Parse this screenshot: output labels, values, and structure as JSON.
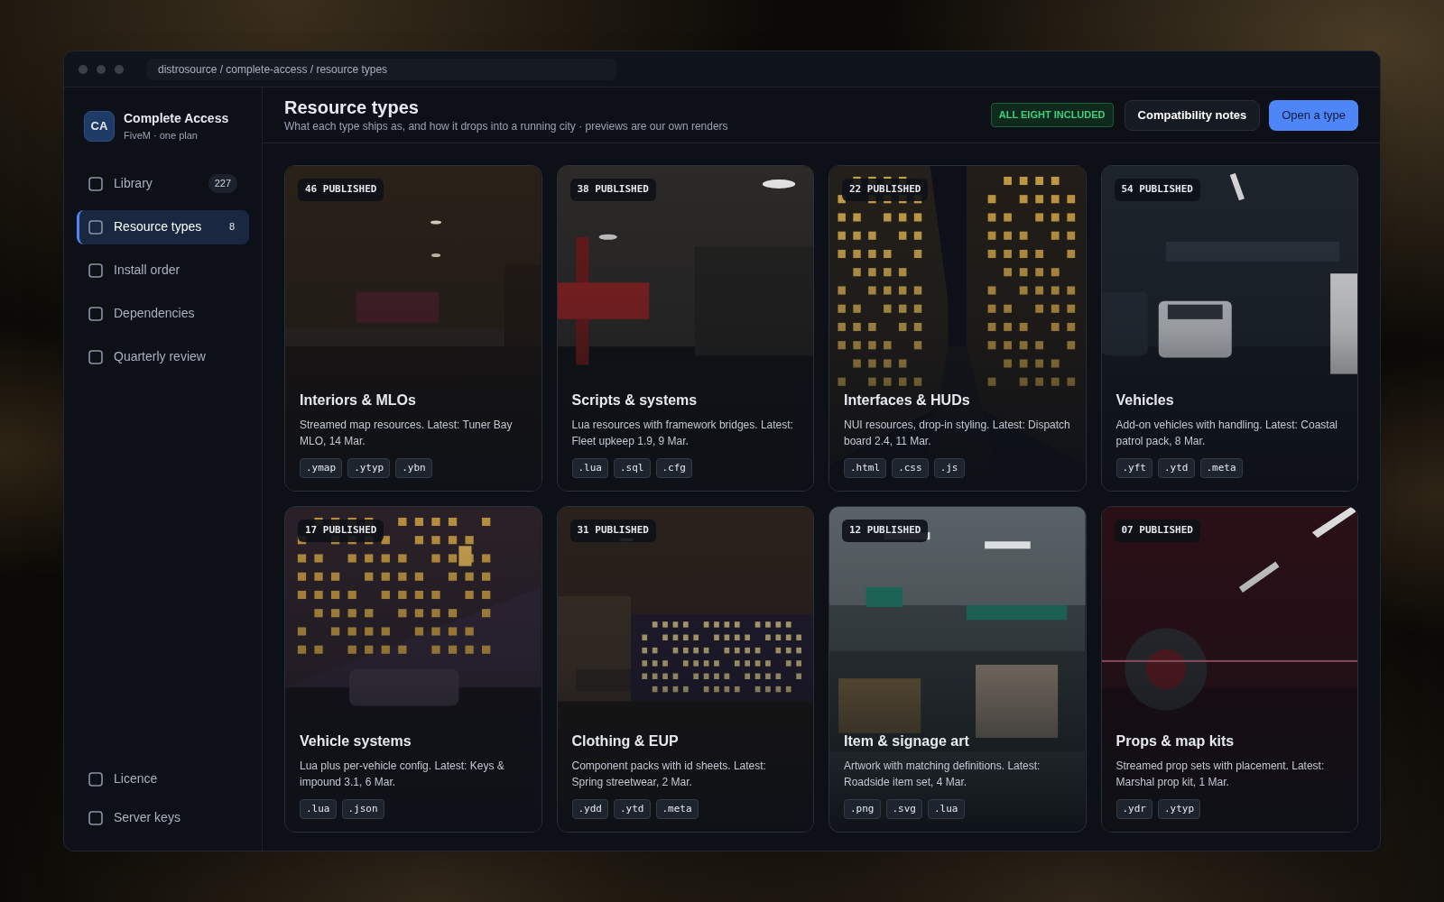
{
  "window": {
    "breadcrumb": "distrosource / complete-access / resource types"
  },
  "brand": {
    "initials": "CA",
    "name": "Complete Access",
    "subtitle": "FiveM · one plan"
  },
  "nav": [
    {
      "label": "Library",
      "count": "227",
      "selected": false
    },
    {
      "label": "Resource types",
      "count": "8",
      "selected": true
    },
    {
      "label": "Install order",
      "selected": false
    },
    {
      "label": "Dependencies",
      "selected": false
    },
    {
      "label": "Quarterly review",
      "selected": false
    }
  ],
  "nav_footer": [
    {
      "label": "Licence"
    },
    {
      "label": "Server keys"
    }
  ],
  "header": {
    "title": "Resource types",
    "subtitle": "What each type ships as, and how it drops into a running city · previews are our own renders",
    "badge": "ALL EIGHT INCLUDED",
    "buttons": [
      {
        "label": "Compatibility notes",
        "kind": "secondary"
      },
      {
        "label": "Open a type",
        "kind": "primary"
      }
    ]
  },
  "cards": [
    {
      "badge": "46 PUBLISHED",
      "title": "Interiors & MLOs",
      "description": "Streamed map resources. Latest: Tuner Bay MLO, 14 Mar.",
      "tags": [
        ".ymap",
        ".ytyp",
        ".ybn"
      ],
      "preview": {
        "kind": "picture"
      }
    },
    {
      "badge": "38 PUBLISHED",
      "title": "Scripts & systems",
      "description": "Lua resources with framework bridges. Latest: Fleet upkeep 1.9, 9 Mar.",
      "tags": [
        ".lua",
        ".sql",
        ".cfg"
      ],
      "preview": {
        "kind": "picture"
      }
    },
    {
      "badge": "22 PUBLISHED",
      "title": "Interfaces & HUDs",
      "description": "NUI resources, drop-in styling. Latest: Dispatch board 2.4, 11 Mar.",
      "tags": [
        ".html",
        ".css",
        ".js"
      ],
      "preview": {
        "kind": "picture"
      }
    },
    {
      "badge": "54 PUBLISHED",
      "title": "Vehicles",
      "description": "Add-on vehicles with handling. Latest: Coastal patrol pack, 8 Mar.",
      "tags": [
        ".yft",
        ".ytd",
        ".meta"
      ],
      "preview": {
        "kind": "picture"
      }
    },
    {
      "badge": "17 PUBLISHED",
      "title": "Vehicle systems",
      "description": "Lua plus per-vehicle config. Latest: Keys & impound 3.1, 6 Mar.",
      "tags": [
        ".lua",
        ".json"
      ],
      "preview": {
        "kind": "picture"
      }
    },
    {
      "badge": "31 PUBLISHED",
      "title": "Clothing & EUP",
      "description": "Component packs with id sheets. Latest: Spring streetwear, 2 Mar.",
      "tags": [
        ".ydd",
        ".ytd",
        ".meta"
      ],
      "preview": {
        "kind": "picture"
      }
    },
    {
      "badge": "12 PUBLISHED",
      "title": "Item & signage art",
      "description": "Artwork with matching definitions. Latest: Roadside item set, 4 Mar.",
      "tags": [
        ".png",
        ".svg",
        ".lua"
      ],
      "preview": {
        "kind": "picture"
      }
    },
    {
      "badge": "07 PUBLISHED",
      "title": "Props & map kits",
      "description": "Streamed prop sets with placement. Latest: Marshal prop kit, 1 Mar.",
      "tags": [
        ".ydr",
        ".ytyp"
      ],
      "preview": {
        "kind": "picture"
      }
    }
  ]
}
